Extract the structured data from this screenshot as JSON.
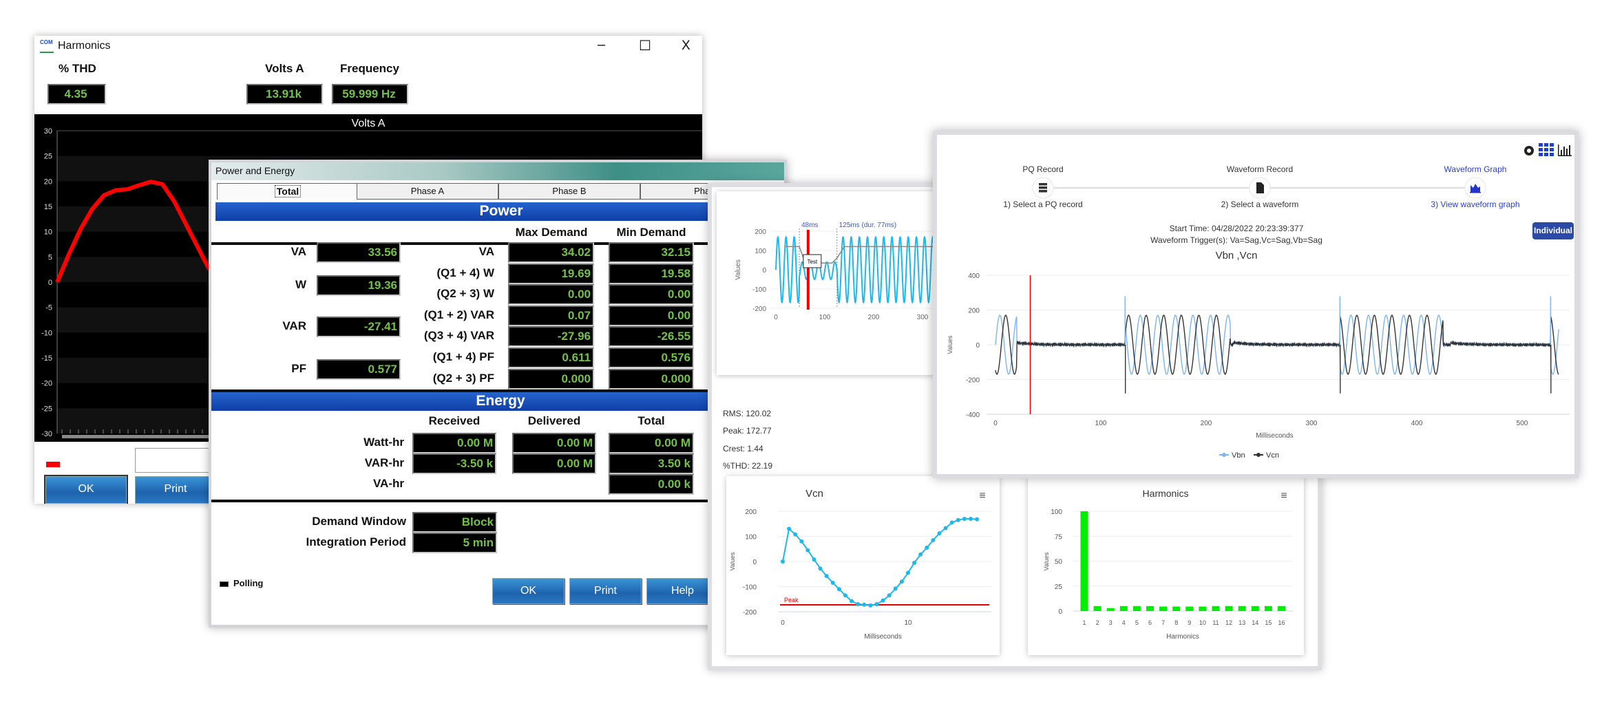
{
  "harmonics_window": {
    "title": "Harmonics",
    "logo_text": "COM",
    "controls": {
      "minimize": "–",
      "maximize": "☐",
      "close": "X"
    },
    "thd_label": "% THD",
    "thd_value": "4.35",
    "volts_label": "Volts A",
    "volts_value": "13.91k",
    "freq_label": "Frequency",
    "freq_value": "59.999 Hz",
    "ok_label": "OK",
    "print_label": "Print",
    "legend_color": "#ff0000"
  },
  "power_window": {
    "title": "Power and Energy",
    "tabs": [
      {
        "label": "Total",
        "active": true
      },
      {
        "label": "Phase A"
      },
      {
        "label": "Phase B"
      },
      {
        "label": "Phase C"
      }
    ],
    "power_title": "Power",
    "max_header": "Max Demand",
    "min_header": "Min Demand",
    "left": [
      {
        "label": "VA",
        "value": "33.56"
      },
      {
        "label": "W",
        "value": "19.36"
      },
      {
        "label": "VAR",
        "value": "-27.41"
      },
      {
        "label": "PF",
        "value": "0.577"
      }
    ],
    "rows": [
      {
        "label": "VA",
        "max": "34.02",
        "min": "32.15"
      },
      {
        "label": "(Q1 + 4) W",
        "max": "19.69",
        "min": "19.58"
      },
      {
        "label": "(Q2 + 3) W",
        "max": "0.00",
        "min": "0.00"
      },
      {
        "label": "(Q1 + 2) VAR",
        "max": "0.07",
        "min": "0.00"
      },
      {
        "label": "(Q3 + 4) VAR",
        "max": "-27.96",
        "min": "-26.55"
      },
      {
        "label": "(Q1 + 4) PF",
        "max": "0.611",
        "min": "0.576"
      },
      {
        "label": "(Q2 + 3) PF",
        "max": "0.000",
        "min": "0.000"
      }
    ],
    "energy_title": "Energy",
    "energy_headers": {
      "received": "Received",
      "delivered": "Delivered",
      "total": "Total"
    },
    "energy_rows": [
      {
        "label": "Watt-hr",
        "received": "0.00 M",
        "delivered": "0.00 M",
        "total": "0.00 M"
      },
      {
        "label": "VAR-hr",
        "received": "-3.50 k",
        "delivered": "0.00 M",
        "total": "3.50 k"
      },
      {
        "label": "VA-hr",
        "total": "0.00 k"
      }
    ],
    "demand_window_label": "Demand Window",
    "demand_window_value": "Block",
    "integration_label": "Integration Period",
    "integration_value": "5 min",
    "polling_label": "Polling",
    "ok_label": "OK",
    "print_label": "Print",
    "help_label": "Help"
  },
  "detail_window": {
    "stats": {
      "rms": "RMS: 120.02",
      "peak": "Peak: 172.77",
      "crest": "Crest: 1.44",
      "thd": "%THD: 22.19"
    }
  },
  "waveform_window": {
    "steps": [
      {
        "title": "PQ Record",
        "subtitle": "1) Select a PQ record",
        "icon": "server-icon"
      },
      {
        "title": "Waveform Record",
        "subtitle": "2) Select a waveform",
        "icon": "file-icon"
      },
      {
        "title": "Waveform Graph",
        "subtitle": "3) View waveform graph",
        "icon": "area-chart-icon",
        "active": true
      }
    ],
    "start_time": "Start Time: 04/28/2022 20:23:39:377",
    "trigger": "Waveform Trigger(s): Va=Sag,Vc=Sag,Vb=Sag",
    "individual_label": "Individual",
    "toolbar_icons": [
      "dashboard-icon",
      "grid-icon",
      "bar-chart-icon"
    ],
    "accent": "#2b4aa8"
  },
  "chart_data": [
    {
      "id": "volts-a",
      "type": "line",
      "title": "Volts A",
      "ylim": [
        -30,
        30
      ],
      "yticks": [
        30,
        25,
        20,
        15,
        10,
        5,
        0,
        -5,
        -10,
        -15,
        -20,
        -25,
        -30
      ],
      "series": [
        {
          "color": "#ff0000",
          "values": [
            0,
            5.5,
            10.5,
            14.5,
            17.2,
            18.2,
            18.4,
            19.2,
            19.9,
            19.4,
            16,
            11.5,
            7,
            2.5
          ]
        }
      ],
      "background": "#000000"
    },
    {
      "id": "sag-waveform",
      "type": "line",
      "ylabel": "Values",
      "xlim": [
        0,
        320
      ],
      "ylim": [
        -200,
        200
      ],
      "xticks": [
        0,
        100,
        200,
        300
      ],
      "yticks": [
        200,
        100,
        0,
        -100,
        -200
      ],
      "markers": [
        {
          "x": 48,
          "label": "48ms"
        },
        {
          "x": 125,
          "label": "125ms (dur. 77ms)"
        }
      ],
      "cursor_x": 66,
      "tooltip": "Test",
      "series": [
        {
          "color": "#1fb8ea"
        },
        {
          "color": "#888888"
        }
      ]
    },
    {
      "id": "vcn",
      "type": "line",
      "title": "Vcn",
      "xlabel": "Milliseconds",
      "ylabel": "Values",
      "xticks": [
        0,
        10
      ],
      "yticks": [
        200,
        100,
        0,
        -100,
        -200
      ],
      "ylim": [
        -200,
        200
      ],
      "x": [
        0,
        0.5,
        1,
        1.5,
        2,
        2.5,
        3,
        3.5,
        4,
        4.5,
        5,
        5.5,
        6,
        6.5,
        7,
        7.5,
        8,
        8.5,
        9,
        9.5,
        10,
        10.5,
        11,
        11.5,
        12,
        12.5,
        13,
        13.5,
        14,
        14.5,
        15,
        15.5
      ],
      "values": [
        0,
        130,
        108,
        80,
        45,
        8,
        -28,
        -58,
        -85,
        -110,
        -135,
        -158,
        -170,
        -172,
        -175,
        -170,
        -155,
        -135,
        -108,
        -80,
        -45,
        -5,
        28,
        55,
        85,
        112,
        133,
        155,
        165,
        170,
        170,
        168
      ],
      "color": "#1fb8ea",
      "peak_line": {
        "label": "Peak",
        "value": -172.77,
        "color": "#e00000"
      }
    },
    {
      "id": "harmonics",
      "type": "bar",
      "title": "Harmonics",
      "xlabel": "Harmonics",
      "ylabel": "Values",
      "categories": [
        "1",
        "2",
        "3",
        "4",
        "5",
        "6",
        "7",
        "8",
        "9",
        "10",
        "11",
        "12",
        "13",
        "14",
        "15",
        "16"
      ],
      "values": [
        100,
        5,
        3,
        5,
        5,
        5,
        4.5,
        4.5,
        4.5,
        4.5,
        5,
        5,
        5,
        5,
        5,
        5
      ],
      "yticks": [
        0,
        25,
        50,
        75,
        100
      ],
      "ylim": [
        0,
        100
      ],
      "color": "#00ee00"
    },
    {
      "id": "vbn-vcn",
      "type": "line",
      "title": "Vbn ,Vcn",
      "xlabel": "Milliseconds",
      "ylabel": "Values",
      "xlim": [
        0,
        535
      ],
      "ylim": [
        -400,
        400
      ],
      "xticks": [
        0,
        100,
        200,
        300,
        400,
        500
      ],
      "yticks": [
        400,
        200,
        0,
        -200,
        -400
      ],
      "trigger_x": 33,
      "legend": "bottom",
      "series": [
        {
          "name": "Vbn",
          "color": "#7cb5ec"
        },
        {
          "name": "Vcn",
          "color": "#333333"
        }
      ]
    }
  ]
}
